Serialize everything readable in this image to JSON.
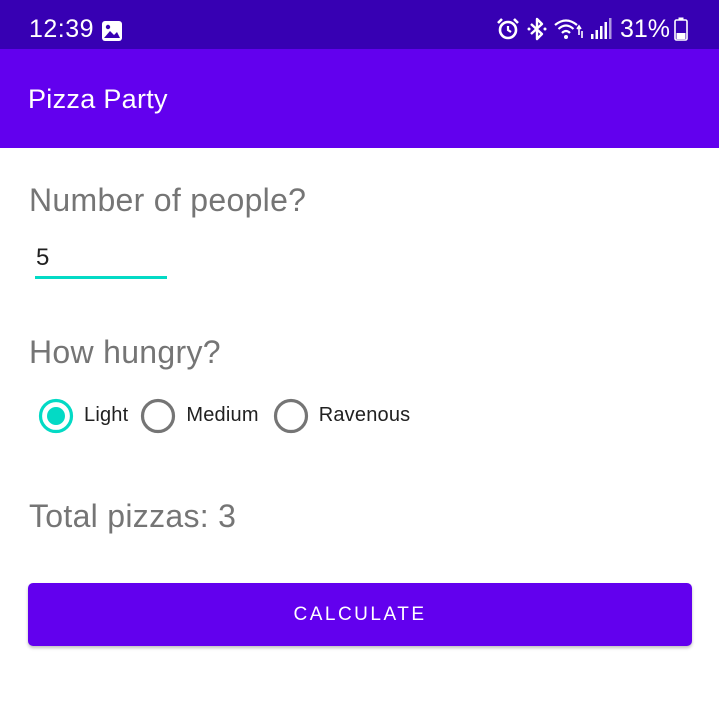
{
  "status_bar": {
    "time": "12:39",
    "battery_percent": "31%",
    "battery_level": 0.31,
    "icons": [
      "gallery-icon",
      "alarm-icon",
      "bluetooth-icon",
      "wifi-icon",
      "signal-icon",
      "battery-icon"
    ]
  },
  "app_bar": {
    "title": "Pizza Party"
  },
  "people": {
    "label": "Number of people?",
    "value": "5"
  },
  "hunger": {
    "label": "How hungry?",
    "options": [
      "Light",
      "Medium",
      "Ravenous"
    ],
    "selected": "Light"
  },
  "result": {
    "text": "Total pizzas: 3"
  },
  "calculate_button": {
    "label": "CALCULATE"
  },
  "colors": {
    "status_bar": "#3700b3",
    "primary": "#6200ee",
    "accent": "#03dac5",
    "label_gray": "#757575",
    "radio_unchecked": "#757575"
  }
}
